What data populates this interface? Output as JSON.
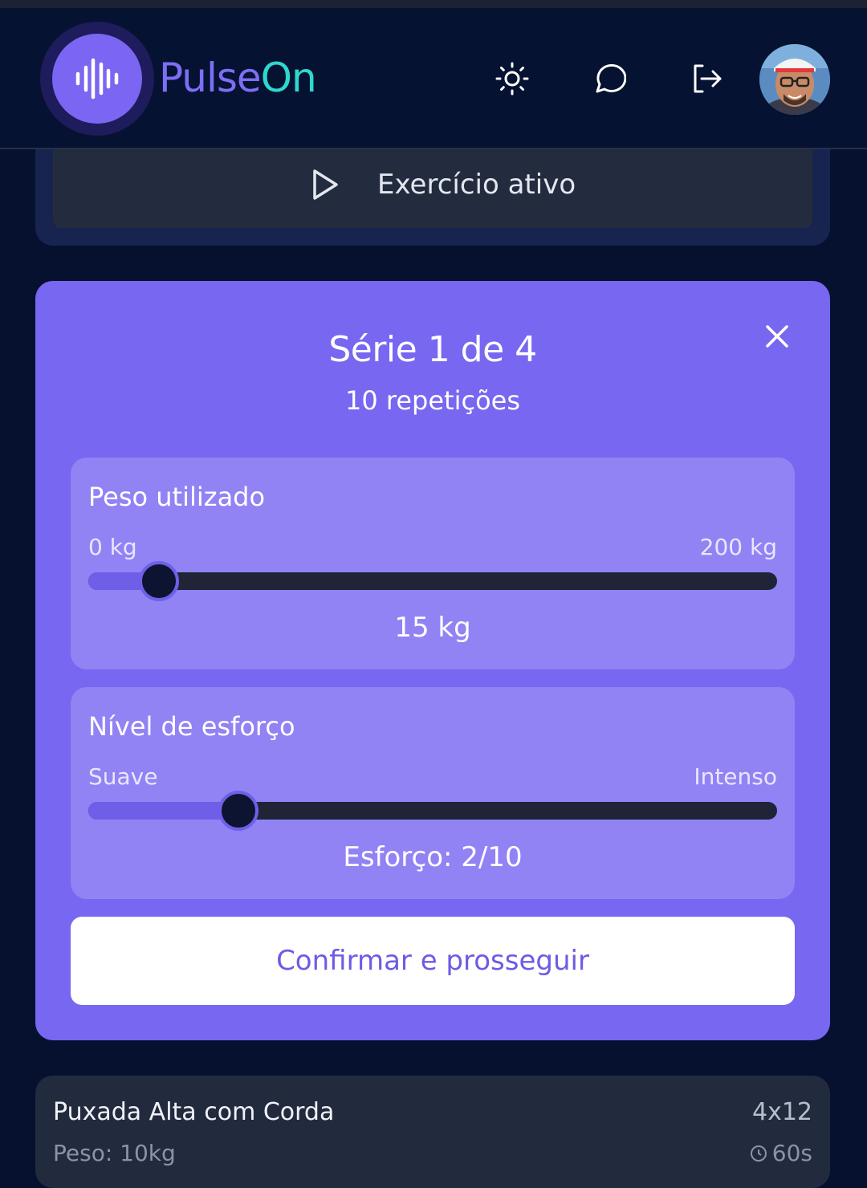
{
  "header": {
    "brand_prefix": "Pulse",
    "brand_suffix": "On",
    "icons": [
      "audio-waveform-icon",
      "sun-icon",
      "chat-icon",
      "logout-icon"
    ]
  },
  "active_exercise": {
    "label": "Exercício ativo"
  },
  "set_modal": {
    "title": "Série 1 de 4",
    "subtitle": "10 repetições",
    "weight": {
      "label": "Peso utilizado",
      "min_label": "0 kg",
      "max_label": "200 kg",
      "min": 0,
      "max": 200,
      "value": 15,
      "value_label": "15 kg"
    },
    "effort": {
      "label": "Nível de esforço",
      "min_label": "Suave",
      "max_label": "Intenso",
      "min": 0,
      "max": 10,
      "value": 2,
      "value_label": "Esforço: 2/10"
    },
    "confirm_label": "Confirmar e prosseguir"
  },
  "exercise_list": [
    {
      "name": "Puxada Alta com Corda",
      "sets": "4x12",
      "weight": "Peso: 10kg",
      "rest": "60s"
    }
  ],
  "colors": {
    "background": "#061130",
    "brand_purple": "#7d6ef5",
    "brand_teal": "#2ed8cf",
    "modal": "#7867f0",
    "panel": "#9183f4",
    "track": "#1f2437"
  }
}
